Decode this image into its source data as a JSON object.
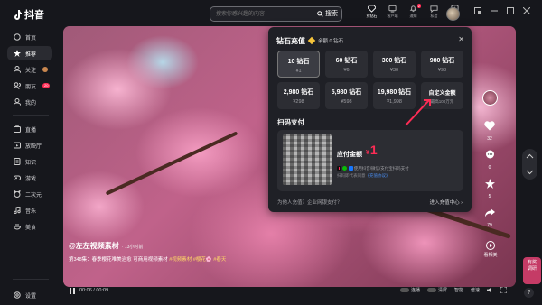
{
  "app": {
    "title": "抖音"
  },
  "search": {
    "placeholder": "搜索你感兴趣的内容",
    "button": "搜索"
  },
  "top_icons": [
    {
      "label": "充钻石",
      "icon": "diamond-icon",
      "active": true
    },
    {
      "label": "客户端",
      "icon": "client-icon"
    },
    {
      "label": "通知",
      "icon": "bell-icon",
      "badge": "2"
    },
    {
      "label": "私信",
      "icon": "message-icon"
    },
    {
      "label": "投稿",
      "icon": "upload-icon"
    }
  ],
  "sidebar": {
    "items": [
      {
        "label": "首页",
        "icon": "home-icon"
      },
      {
        "label": "推荐",
        "icon": "recommend-icon",
        "active": true
      },
      {
        "label": "关注",
        "icon": "follow-icon"
      },
      {
        "label": "朋友",
        "icon": "friends-icon",
        "badge": "20"
      },
      {
        "label": "我的",
        "icon": "profile-icon"
      },
      {
        "label": "直播",
        "icon": "live-icon"
      },
      {
        "label": "放映厅",
        "icon": "cinema-icon"
      },
      {
        "label": "知识",
        "icon": "knowledge-icon"
      },
      {
        "label": "游戏",
        "icon": "game-icon"
      },
      {
        "label": "二次元",
        "icon": "anime-icon"
      },
      {
        "label": "音乐",
        "icon": "music-icon"
      },
      {
        "label": "美食",
        "icon": "food-icon"
      }
    ],
    "settings": "设置"
  },
  "video": {
    "author": "@左左视频素材",
    "time": "· 13小时前",
    "desc_plain": "第348集：春季樱花唯美治愈 可商用视频素材 ",
    "tags": [
      "#视频素材",
      "#樱花🌸",
      "#春天"
    ],
    "current_time": "00:06",
    "duration": "00:09",
    "ctrl": {
      "autoplay": "连播",
      "clear": "清屏",
      "smart": "智能",
      "speed": "倍速"
    }
  },
  "actions": {
    "likes": "32",
    "comments": "0",
    "favorites": "5",
    "shares": "79",
    "more": "看相关"
  },
  "side_tools": {
    "feedback": "有奖\n调研",
    "help": "?"
  },
  "recharge": {
    "title": "钻石充值",
    "balance": "余额 0 钻石",
    "options": [
      {
        "amount": "10 钻石",
        "price": "¥1",
        "selected": true
      },
      {
        "amount": "60 钻石",
        "price": "¥6"
      },
      {
        "amount": "300 钻石",
        "price": "¥30"
      },
      {
        "amount": "980 钻石",
        "price": "¥98"
      },
      {
        "amount": "2,980 钻石",
        "price": "¥298"
      },
      {
        "amount": "5,980 钻石",
        "price": "¥598"
      },
      {
        "amount": "19,980 钻石",
        "price": "¥1,998"
      },
      {
        "amount": "自定义金额",
        "price": "最高100万元",
        "custom": true
      }
    ],
    "scan_title": "扫码支付",
    "amount_label": "应付金额",
    "amount_currency": "¥",
    "amount_value": "1",
    "pay_note": "使用抖音/微信/支付宝扫码支付",
    "agree_prefix": "扫码即代表同意",
    "agree_link": "《充值协议》",
    "footer_left": "为他人充值？企业网银支付？",
    "footer_right": "进入充值中心 ›"
  },
  "colors": {
    "accent": "#fe2c55",
    "tag": "#ffd966",
    "link": "#4a8df0"
  }
}
